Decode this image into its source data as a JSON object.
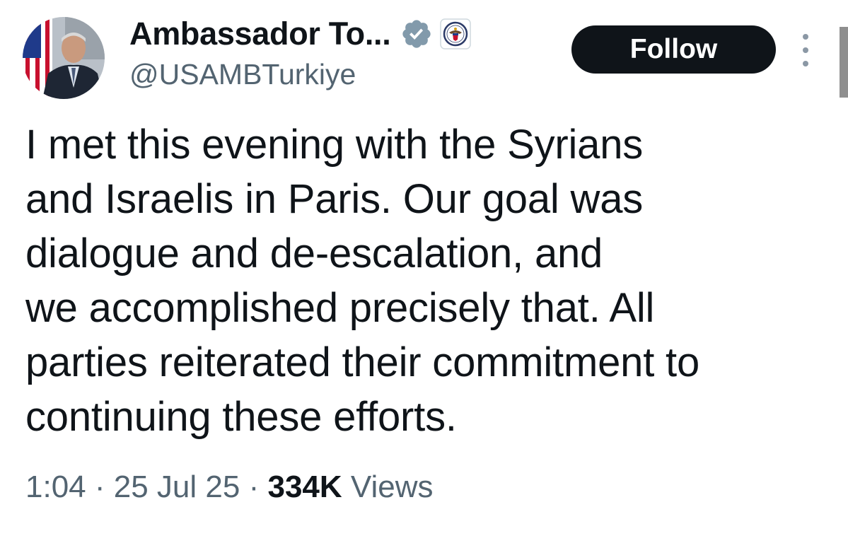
{
  "author": {
    "display_name": "Ambassador To...",
    "handle": "@USAMBTurkiye",
    "avatar_icon": "profile-photo",
    "verified_badge_icon": "verified-badge-icon",
    "verified_badge_color": "#829aab",
    "affiliation_icon": "state-department-seal-icon"
  },
  "actions": {
    "follow_label": "Follow",
    "more_icon": "more-vertical-icon"
  },
  "tweet": {
    "text": "I met this evening with the Syrians\nand Israelis in Paris. Our goal was\ndialogue and de-escalation, and\nwe accomplished precisely that. All\nparties reiterated their commitment to\ncontinuing these efforts.",
    "time": "1:04",
    "separator": "·",
    "date": "25 Jul 25",
    "views_count": "334K",
    "views_label": "Views"
  },
  "colors": {
    "primary_text": "#0f1419",
    "secondary_text": "#536471",
    "follow_button_bg": "#0f1419",
    "follow_button_text": "#ffffff"
  }
}
